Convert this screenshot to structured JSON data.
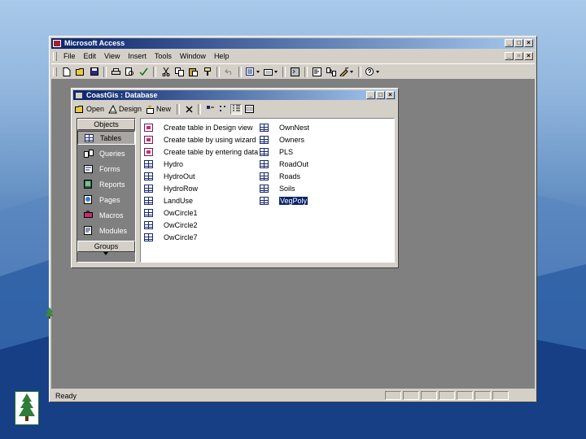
{
  "app": {
    "title": "Microsoft Access",
    "window_buttons": [
      "_",
      "□",
      "×"
    ],
    "mdi_buttons": [
      "_",
      "▫",
      "×"
    ],
    "menu": [
      "File",
      "Edit",
      "View",
      "Insert",
      "Tools",
      "Window",
      "Help"
    ],
    "status": "Ready"
  },
  "db_window": {
    "title": "CoastGis : Database",
    "window_buttons": [
      "_",
      "□",
      "×"
    ],
    "toolbar": {
      "open": "Open",
      "design": "Design",
      "new": "New"
    },
    "objects_header": "Objects",
    "objects": [
      "Tables",
      "Queries",
      "Forms",
      "Reports",
      "Pages",
      "Macros",
      "Modules"
    ],
    "selected_object": "Tables",
    "groups_label": "Groups",
    "list_col1": [
      "Create table in Design view",
      "Create table by using wizard",
      "Create table by entering data",
      "Hydro",
      "HydroOut",
      "HydroRow",
      "LandUse",
      "OwCircle1",
      "OwCircle2",
      "OwCircle7"
    ],
    "list_col2": [
      "OwnNest",
      "Owners",
      "PLS",
      "RoadOut",
      "Roads",
      "Soils",
      "VegPoly"
    ],
    "selected_table": "VegPoly"
  },
  "colors": {
    "titlebar_start": "#0a246a",
    "titlebar_end": "#a6caf0",
    "face": "#d4d0c8",
    "workspace": "#808080"
  }
}
